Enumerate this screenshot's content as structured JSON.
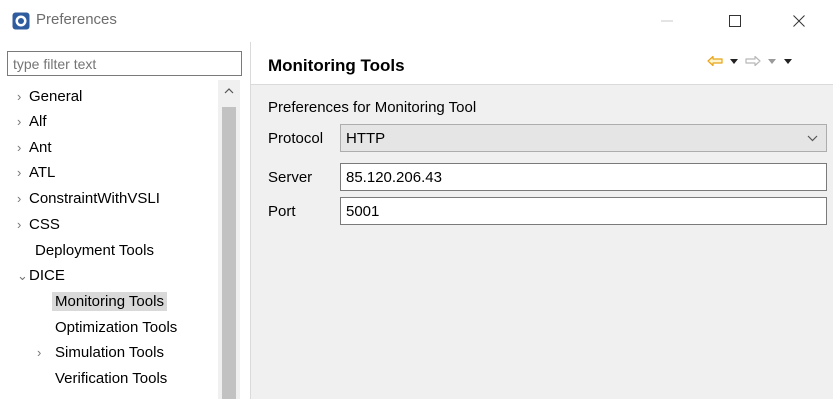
{
  "window": {
    "title": "Preferences",
    "controls": {
      "minimize_icon": "minimize-icon",
      "maximize_icon": "maximize-icon",
      "close_icon": "close-icon"
    }
  },
  "sidebar": {
    "filter_placeholder": "type filter text",
    "items": [
      {
        "label": "General",
        "expander": "collapsed",
        "level": 0
      },
      {
        "label": "Alf",
        "expander": "collapsed",
        "level": 0
      },
      {
        "label": "Ant",
        "expander": "collapsed",
        "level": 0
      },
      {
        "label": "ATL",
        "expander": "collapsed",
        "level": 0
      },
      {
        "label": "ConstraintWithVSLI",
        "expander": "collapsed",
        "level": 0
      },
      {
        "label": "CSS",
        "expander": "collapsed",
        "level": 0
      },
      {
        "label": "Deployment Tools",
        "expander": "none",
        "level": 0
      },
      {
        "label": "DICE",
        "expander": "expanded",
        "level": 0
      },
      {
        "label": "Monitoring Tools",
        "expander": "none",
        "level": 1,
        "selected": true
      },
      {
        "label": "Optimization Tools",
        "expander": "none",
        "level": 1
      },
      {
        "label": "Simulation Tools",
        "expander": "collapsed",
        "level": 1
      },
      {
        "label": "Verification Tools",
        "expander": "none",
        "level": 1
      }
    ]
  },
  "main": {
    "title": "Monitoring Tools",
    "description": "Preferences for Monitoring Tool",
    "protocol": {
      "label": "Protocol",
      "value": "HTTP"
    },
    "server": {
      "label": "Server",
      "value": "85.120.206.43"
    },
    "port": {
      "label": "Port",
      "value": "5001"
    }
  },
  "colors": {
    "accent_back_arrow": "#e8a317",
    "selection": "#d9d9d9",
    "panel_bg": "#f0f0f0"
  }
}
